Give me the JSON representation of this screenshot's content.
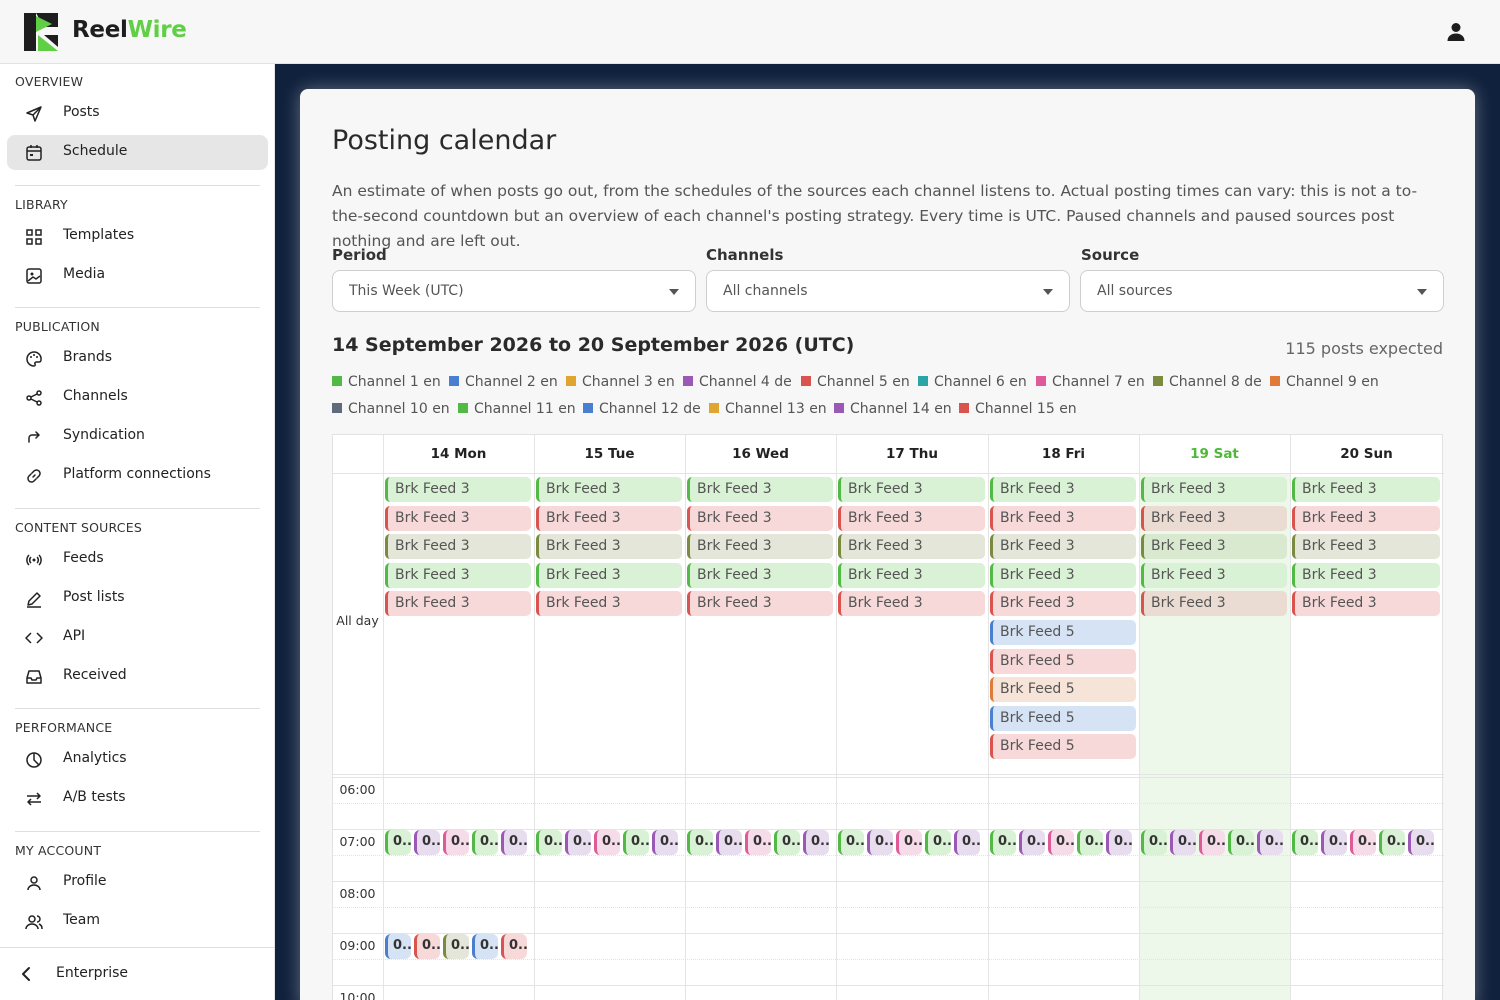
{
  "brand": {
    "name_part1": "Reel",
    "name_part2": "Wire",
    "accent": "#5fcf45"
  },
  "header": {
    "user_icon": "user-icon"
  },
  "sidebar": {
    "sections": [
      {
        "title": "OVERVIEW",
        "items": [
          {
            "label": "Posts",
            "icon": "send-icon"
          },
          {
            "label": "Schedule",
            "icon": "calendar-icon",
            "active": true
          }
        ]
      },
      {
        "title": "LIBRARY",
        "items": [
          {
            "label": "Templates",
            "icon": "grid-icon"
          },
          {
            "label": "Media",
            "icon": "image-icon"
          }
        ]
      },
      {
        "title": "PUBLICATION",
        "items": [
          {
            "label": "Brands",
            "icon": "palette-icon"
          },
          {
            "label": "Channels",
            "icon": "share-icon"
          },
          {
            "label": "Syndication",
            "icon": "forward-icon"
          },
          {
            "label": "Platform connections",
            "icon": "link-icon"
          }
        ]
      },
      {
        "title": "CONTENT SOURCES",
        "items": [
          {
            "label": "Feeds",
            "icon": "broadcast-icon"
          },
          {
            "label": "Post lists",
            "icon": "pencil-icon"
          },
          {
            "label": "API",
            "icon": "code-icon"
          },
          {
            "label": "Received",
            "icon": "inbox-icon"
          }
        ]
      },
      {
        "title": "PERFORMANCE",
        "items": [
          {
            "label": "Analytics",
            "icon": "pie-chart-icon"
          },
          {
            "label": "A/B tests",
            "icon": "swap-icon"
          }
        ]
      },
      {
        "title": "MY ACCOUNT",
        "items": [
          {
            "label": "Profile",
            "icon": "person-icon"
          },
          {
            "label": "Team",
            "icon": "team-icon"
          }
        ]
      }
    ],
    "footer": {
      "label": "Enterprise",
      "icon": "chevron-left-icon"
    }
  },
  "page": {
    "title": "Posting calendar",
    "description": "An estimate of when posts go out, from the schedules of the sources each channel listens to. Actual posting times can vary: this is not a to-the-second countdown but an overview of each channel's posting strategy. Every time is UTC. Paused channels and paused sources post nothing and are left out."
  },
  "filters": {
    "period": {
      "label": "Period",
      "value": "This Week (UTC)"
    },
    "channels": {
      "label": "Channels",
      "value": "All channels"
    },
    "source": {
      "label": "Source",
      "value": "All sources"
    }
  },
  "summary": {
    "range": "14 September 2026 to 20 September 2026 (UTC)",
    "count": "115 posts expected"
  },
  "legend": [
    {
      "label": "Channel 1 en",
      "color": "#52b946"
    },
    {
      "label": "Channel 2 en",
      "color": "#4a7fd0"
    },
    {
      "label": "Channel 3 en",
      "color": "#e0a530"
    },
    {
      "label": "Channel 4 de",
      "color": "#9b59b6"
    },
    {
      "label": "Channel 5 en",
      "color": "#d9534f"
    },
    {
      "label": "Channel 6 en",
      "color": "#2aa5a5"
    },
    {
      "label": "Channel 7 en",
      "color": "#e05a9a"
    },
    {
      "label": "Channel 8 de",
      "color": "#7a8a3e"
    },
    {
      "label": "Channel 9 en",
      "color": "#e07a3a"
    },
    {
      "label": "Channel 10 en",
      "color": "#5f6b7a"
    },
    {
      "label": "Channel 11 en",
      "color": "#52b946"
    },
    {
      "label": "Channel 12 de",
      "color": "#4a7fd0"
    },
    {
      "label": "Channel 13 en",
      "color": "#e0a530"
    },
    {
      "label": "Channel 14 en",
      "color": "#9b59b6"
    },
    {
      "label": "Channel 15 en",
      "color": "#d9534f"
    }
  ],
  "calendar": {
    "all_day_label": "All day",
    "days": [
      {
        "label": "14 Mon",
        "today": false
      },
      {
        "label": "15 Tue",
        "today": false
      },
      {
        "label": "16 Wed",
        "today": false
      },
      {
        "label": "17 Thu",
        "today": false
      },
      {
        "label": "18 Fri",
        "today": false
      },
      {
        "label": "19 Sat",
        "today": true
      },
      {
        "label": "20 Sun",
        "today": false
      }
    ],
    "all_day_events": [
      [
        {
          "t": "Brk Feed 3",
          "c": "green"
        },
        {
          "t": "Brk Feed 3",
          "c": "red"
        },
        {
          "t": "Brk Feed 3",
          "c": "olive"
        },
        {
          "t": "Brk Feed 3",
          "c": "green"
        },
        {
          "t": "Brk Feed 3",
          "c": "red"
        }
      ],
      [
        {
          "t": "Brk Feed 3",
          "c": "green"
        },
        {
          "t": "Brk Feed 3",
          "c": "red"
        },
        {
          "t": "Brk Feed 3",
          "c": "olive"
        },
        {
          "t": "Brk Feed 3",
          "c": "green"
        },
        {
          "t": "Brk Feed 3",
          "c": "red"
        }
      ],
      [
        {
          "t": "Brk Feed 3",
          "c": "green"
        },
        {
          "t": "Brk Feed 3",
          "c": "red"
        },
        {
          "t": "Brk Feed 3",
          "c": "olive"
        },
        {
          "t": "Brk Feed 3",
          "c": "green"
        },
        {
          "t": "Brk Feed 3",
          "c": "red"
        }
      ],
      [
        {
          "t": "Brk Feed 3",
          "c": "green"
        },
        {
          "t": "Brk Feed 3",
          "c": "red"
        },
        {
          "t": "Brk Feed 3",
          "c": "olive"
        },
        {
          "t": "Brk Feed 3",
          "c": "green"
        },
        {
          "t": "Brk Feed 3",
          "c": "red"
        }
      ],
      [
        {
          "t": "Brk Feed 3",
          "c": "green"
        },
        {
          "t": "Brk Feed 3",
          "c": "red"
        },
        {
          "t": "Brk Feed 3",
          "c": "olive"
        },
        {
          "t": "Brk Feed 3",
          "c": "green"
        },
        {
          "t": "Brk Feed 3",
          "c": "red"
        },
        {
          "t": "Brk Feed 5",
          "c": "blue"
        },
        {
          "t": "Brk Feed 5",
          "c": "red"
        },
        {
          "t": "Brk Feed 5",
          "c": "orange"
        },
        {
          "t": "Brk Feed 5",
          "c": "blue"
        },
        {
          "t": "Brk Feed 5",
          "c": "red"
        }
      ],
      [
        {
          "t": "Brk Feed 3",
          "c": "green"
        },
        {
          "t": "Brk Feed 3",
          "c": "sat-red"
        },
        {
          "t": "Brk Feed 3",
          "c": "sat-olive"
        },
        {
          "t": "Brk Feed 3",
          "c": "green"
        },
        {
          "t": "Brk Feed 3",
          "c": "sat-red"
        }
      ],
      [
        {
          "t": "Brk Feed 3",
          "c": "green"
        },
        {
          "t": "Brk Feed 3",
          "c": "red"
        },
        {
          "t": "Brk Feed 3",
          "c": "olive"
        },
        {
          "t": "Brk Feed 3",
          "c": "green"
        },
        {
          "t": "Brk Feed 3",
          "c": "red"
        }
      ]
    ],
    "time_labels": [
      "06:00",
      "07:00",
      "08:00",
      "09:00",
      "10:00"
    ],
    "chip_text": "0..",
    "chips_0700": [
      "green",
      "purple",
      "pink",
      "green",
      "purple"
    ],
    "chips_0900": [
      "blue",
      "red",
      "olive",
      "blue",
      "red"
    ]
  }
}
